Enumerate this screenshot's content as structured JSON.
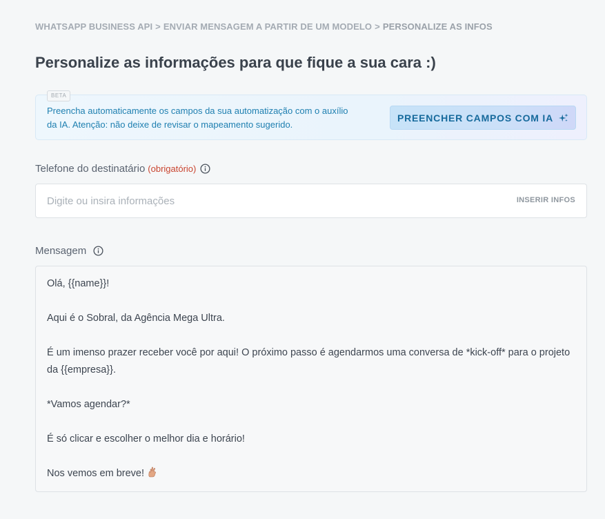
{
  "breadcrumb": {
    "items": [
      "WHATSAPP BUSINESS API",
      "ENVIAR MENSAGEM A PARTIR DE UM MODELO",
      "PERSONALIZE AS INFOS"
    ],
    "separator": ">"
  },
  "page_title": "Personalize as informações para que fique a sua cara :)",
  "ai_box": {
    "badge": "BETA",
    "text": "Preencha automaticamente os campos da sua automatização com o auxílio da IA. Atenção: não deixe de revisar o mapeamento sugerido.",
    "button_label": "PREENCHER CAMPOS COM IA",
    "button_icon": "sparkle-icon"
  },
  "phone_field": {
    "label": "Telefone do destinatário",
    "required_text": "(obrigatório)",
    "placeholder": "Digite ou insira informações",
    "value": "",
    "insert_label": "INSERIR INFOS",
    "info_icon": "info-icon"
  },
  "message_field": {
    "label": "Mensagem",
    "info_icon": "info-icon",
    "lines": [
      "Olá, {{name}}!",
      "",
      "Aqui é o Sobral, da Agência Mega Ultra.",
      "",
      "É um imenso prazer receber você por aqui! O próximo passo é agendarmos uma conversa de *kick-off* para o projeto da {{empresa}}.",
      "",
      "*Vamos agendar?*",
      "",
      "É só clicar e escolher o melhor dia e horário!",
      "",
      "Nos vemos em breve!"
    ],
    "trailing_emoji": "crossed-fingers-icon"
  },
  "colors": {
    "background": "#f5f7f8",
    "accent_text": "#1e7fb0",
    "button_bg": "#c7e3f8",
    "required": "#c9442f",
    "title": "#3a424c",
    "breadcrumb": "#a4abb3"
  }
}
